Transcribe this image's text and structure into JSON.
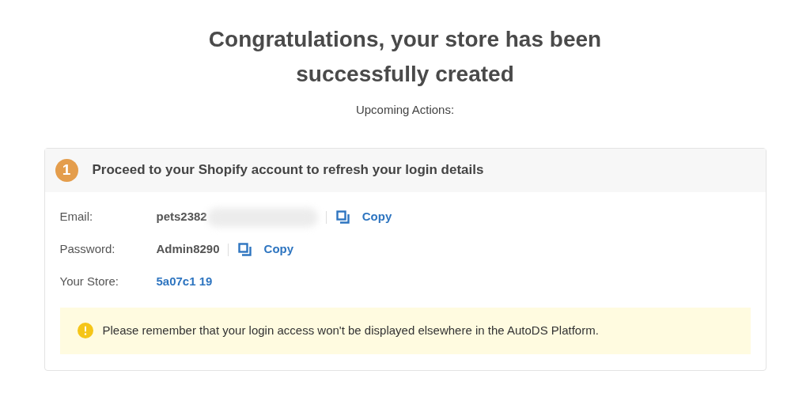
{
  "title": "Congratulations, your store has been successfully created",
  "subtitle": "Upcoming Actions:",
  "step": {
    "number": "1",
    "heading": "Proceed to your Shopify account to refresh your login details",
    "rows": [
      {
        "kind": "copyable",
        "label": "Email:",
        "value": "pets2382",
        "redacted": true,
        "action": "Copy"
      },
      {
        "kind": "copyable",
        "label": "Password:",
        "value": "Admin8290",
        "redacted": false,
        "action": "Copy"
      },
      {
        "kind": "link",
        "label": "Your Store:",
        "value": "5a07c1 19"
      }
    ],
    "notice": "Please remember that your login access won't be displayed elsewhere in the AutoDS Platform."
  }
}
